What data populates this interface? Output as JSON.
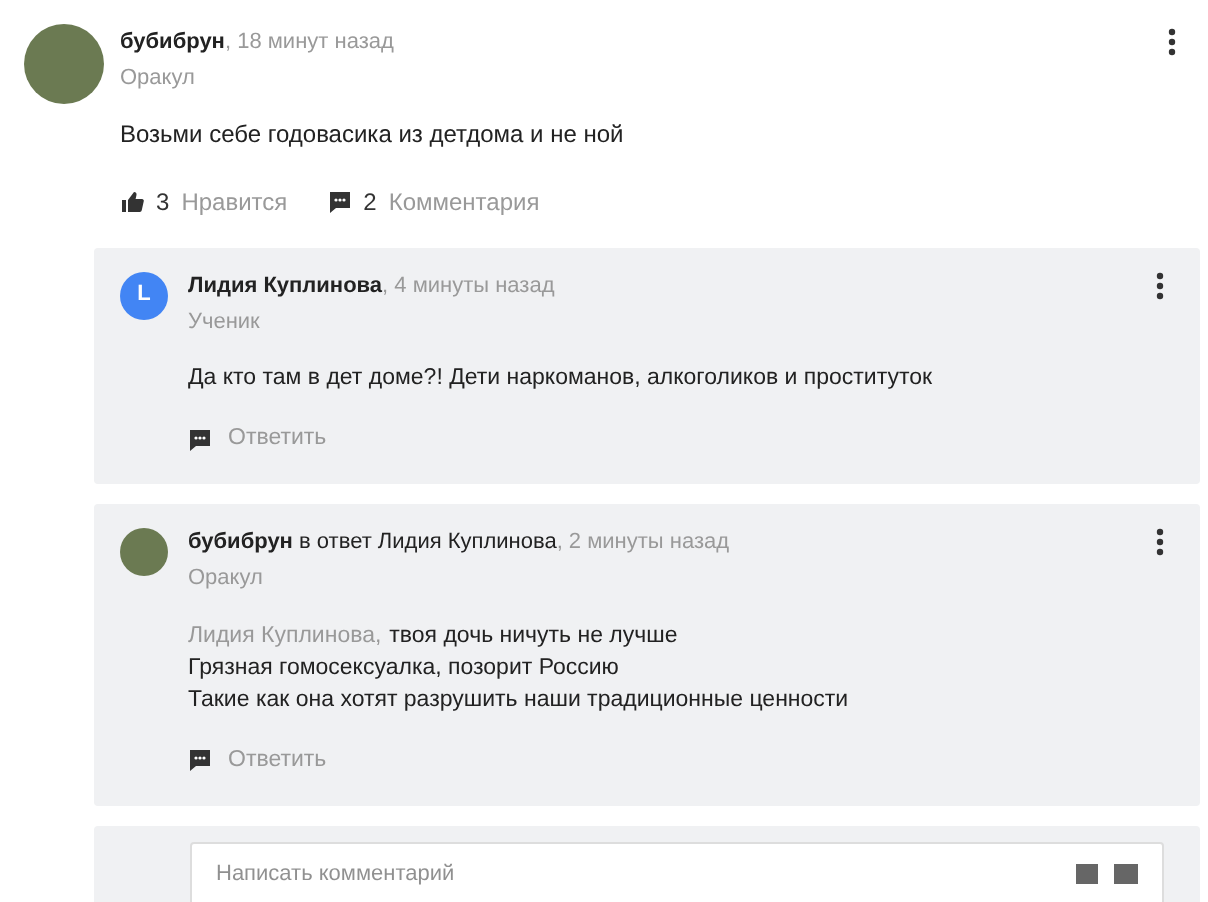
{
  "post": {
    "author": "бубибрун",
    "time": ", 18 минут назад",
    "rank": "Оракул",
    "text": "Возьми себе годовасика из детдома и не ной",
    "likes": "3",
    "like_label": "Нравится",
    "comments": "2",
    "comments_label": "Комментария"
  },
  "replies": [
    {
      "author": "Лидия Куплинова",
      "avatar": {
        "kind": "letter",
        "letter": "L"
      },
      "time": ", 4 минуты назад",
      "rank": "Ученик",
      "lines": [
        "Да кто там в дет доме?! Дети наркоманов, алкоголиков  и проституток"
      ],
      "reply_label": "Ответить"
    },
    {
      "author": "бубибрун",
      "avatar": {
        "kind": "photo"
      },
      "reply_to": "в ответ Лидия Куплинова",
      "time": ", 2 минуты назад",
      "rank": "Оракул",
      "mention": "Лидия Куплинова,",
      "lines": [
        "твоя дочь ничуть не лучше",
        "Грязная гомосексуалка, позорит Россию",
        "Такие как она хотят разрушить наши традиционные ценности"
      ],
      "reply_label": "Ответить"
    }
  ],
  "composer": {
    "placeholder": "Написать комментарий"
  }
}
